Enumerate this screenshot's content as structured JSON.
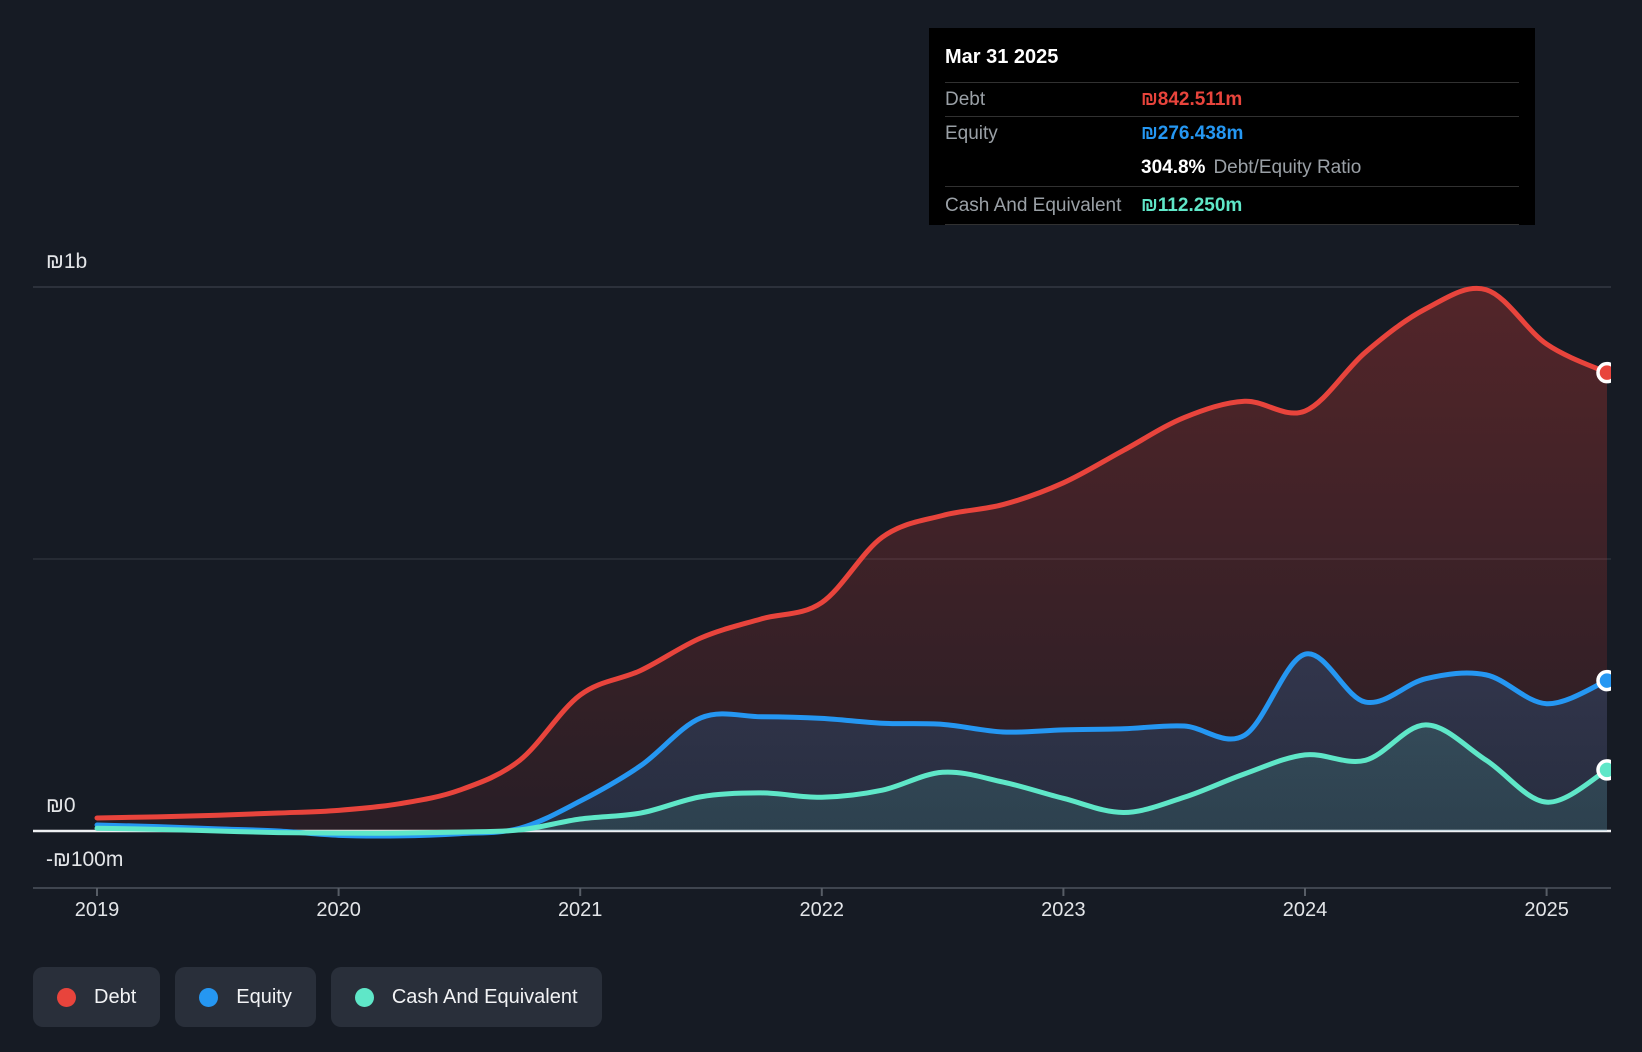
{
  "colors": {
    "background": "#161b24",
    "debt": "#e8443c",
    "equity": "#2597f2",
    "cash": "#5fe7c8",
    "zero_line": "#eef0f2",
    "gridline": "#333943",
    "axis_line": "#3f454f",
    "tooltip_bg": "#000000",
    "legend_chip_bg": "#292f3a"
  },
  "tooltip": {
    "date": "Mar 31 2025",
    "debt": {
      "label": "Debt",
      "value": "₪842.511m"
    },
    "equity": {
      "label": "Equity",
      "value": "₪276.438m"
    },
    "ratio": {
      "value": "304.8%",
      "label": "Debt/Equity Ratio"
    },
    "cash": {
      "label": "Cash And Equivalent",
      "value": "₪112.250m"
    }
  },
  "legend": {
    "items": [
      {
        "id": "debt",
        "label": "Debt",
        "color": "#e8443c"
      },
      {
        "id": "equity",
        "label": "Equity",
        "color": "#2597f2"
      },
      {
        "id": "cash",
        "label": "Cash And Equivalent",
        "color": "#5fe7c8"
      }
    ]
  },
  "chart_data": {
    "type": "area",
    "title": "",
    "unit": "NIS millions (₪m)",
    "grid": "horizontal",
    "legend_position": "bottom-left",
    "ylim": [
      -100,
      1050
    ],
    "x_year_labels": [
      "2019",
      "2020",
      "2021",
      "2022",
      "2023",
      "2024",
      "2025"
    ],
    "y_ticks": [
      {
        "label": "₪1b",
        "value": 1000
      },
      {
        "label": "",
        "value": 500
      },
      {
        "label": "₪0",
        "value": 0
      },
      {
        "label": "-₪100m",
        "value": -100
      }
    ],
    "x": [
      "2018-12-31",
      "2019-03-31",
      "2019-06-30",
      "2019-09-30",
      "2019-12-31",
      "2020-03-31",
      "2020-06-30",
      "2020-09-30",
      "2020-12-31",
      "2021-03-31",
      "2021-06-30",
      "2021-09-30",
      "2021-12-31",
      "2022-03-31",
      "2022-06-30",
      "2022-09-30",
      "2022-12-31",
      "2023-03-31",
      "2023-06-30",
      "2023-09-30",
      "2023-12-31",
      "2024-03-31",
      "2024-06-30",
      "2024-09-30",
      "2024-12-31",
      "2025-03-31"
    ],
    "series": [
      {
        "name": "Debt",
        "id": "debt",
        "color": "#e8443c",
        "fill_top": "rgba(231,62,54,0.30)",
        "fill_bottom": "rgba(231,62,54,0.08)",
        "values": [
          24,
          26,
          29,
          33,
          38,
          50,
          75,
          130,
          250,
          295,
          355,
          390,
          420,
          540,
          580,
          600,
          640,
          700,
          760,
          790,
          772,
          880,
          960,
          995,
          895,
          842.511
        ]
      },
      {
        "name": "Equity",
        "id": "equity",
        "color": "#2597f2",
        "fill_top": "rgba(33,150,243,0.30)",
        "fill_bottom": "rgba(33,150,243,0.12)",
        "values": [
          11,
          8,
          4,
          0,
          -8,
          -9,
          -5,
          5,
          55,
          120,
          208,
          210,
          207,
          198,
          196,
          182,
          186,
          188,
          193,
          176,
          325,
          237,
          280,
          287,
          234,
          276.438
        ]
      },
      {
        "name": "Cash And Equivalent",
        "id": "cash",
        "color": "#5fe7c8",
        "fill_top": "rgba(92,228,200,0.25)",
        "fill_bottom": "rgba(92,228,200,0.10)",
        "values": [
          5,
          3,
          0,
          -3,
          -4,
          -4,
          -2,
          2,
          22,
          33,
          63,
          70,
          62,
          75,
          108,
          90,
          60,
          34,
          62,
          105,
          140,
          130,
          195,
          130,
          53,
          112.25
        ]
      }
    ],
    "highlighted_point": {
      "date": "Mar 31 2025",
      "debt_m": 842.511,
      "equity_m": 276.438,
      "debt_equity_ratio_pct": 304.8,
      "cash_m": 112.25
    }
  }
}
